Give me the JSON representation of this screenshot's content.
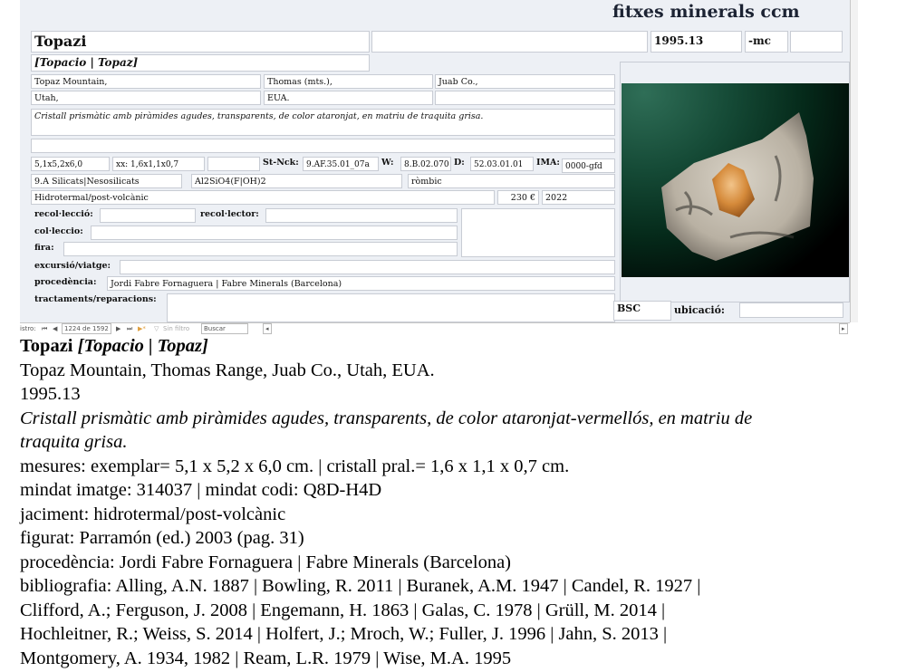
{
  "form": {
    "app_title": "fitxes minerals ccm",
    "name": "Topazi",
    "name_extra": "",
    "catalog_number": "1995.13",
    "suffix": "-mc",
    "extra_code": "",
    "synonyms": "[Topacio | Topaz]",
    "locality": [
      "Topaz Mountain,",
      "Thomas (mts.),",
      "Juab Co.,"
    ],
    "locality2": [
      "Utah,",
      "EUA.",
      ""
    ],
    "description": "Cristall prismàtic amb piràmides agudes, transparents, de color ataronjat, en matriu de traquita grisa.",
    "blank_line": "",
    "size": "5,1x5,2x6,0",
    "crystal_size": "xx: 1,6x1,1x0,7",
    "size_extra": "",
    "strunz_label": "St-Nck:",
    "strunz_value": "9.AF.35.01_07a",
    "w_label": "W:",
    "w_value": "8.B.02.070",
    "d_label": "D:",
    "d_value": "52.03.01.01",
    "ima_label": "IMA:",
    "ima_value": "0000-gfd",
    "class": "9.A Silicats|Nesosilicats",
    "formula": "Al2SiO4(F|OH)2",
    "system": "ròmbic",
    "deposit": "Hidrotermal/post-volcànic",
    "price": "230 €",
    "year": "2022",
    "recollection_label": "recol·lecció:",
    "recollection_value": "",
    "collector_label": "recol·lector:",
    "collector_value": "",
    "collection_label": "col·leccio:",
    "collection_value": "",
    "fair_label": "fira:",
    "fair_value": "",
    "trip_label": "excursió/viatge:",
    "trip_value": "",
    "provenance_label": "procedència:",
    "provenance_value": "Jordi Fabre Fornaguera | Fabre Minerals (Barcelona)",
    "treatments_label": "tractaments/reparacions:",
    "treatments_value": "",
    "bsc": "BSC",
    "location_label": "ubicació:",
    "location_value": "",
    "photo_alt": "topaz crystal on grey matrix"
  },
  "navigation": {
    "record_label": "istro:",
    "first": "⏮",
    "prev": "◀",
    "position": "1224 de 1592",
    "next": "▶",
    "last": "⏭",
    "new": "▶*",
    "filter": "Sin filtro",
    "search_placeholder": "Buscar"
  },
  "report": {
    "name": "Topazi",
    "synonyms": "[Topacio | Topaz]",
    "locality": "Topaz Mountain, Thomas Range, Juab Co., Utah, EUA.",
    "catalog_number": "1995.13",
    "description_1": "Cristall prismàtic amb piràmides agudes, transparents, de color ataronjat-vermellós, en matriu de",
    "description_2": "traquita grisa.",
    "measures": "mesures: exemplar= 5,1 x 5,2 x 6,0 cm. | cristall pral.= 1,6 x 1,1 x 0,7 cm.",
    "mindat": "mindat imatge: 314037 | mindat codi: Q8D-H4D",
    "deposit": "jaciment: hidrotermal/post-volcànic",
    "figured": "figurat: Parramón (ed.) 2003 (pag. 31)",
    "provenance": "procedència: Jordi Fabre Fornaguera | Fabre Minerals (Barcelona)",
    "bibliography": [
      "bibliografia: Alling, A.N. 1887 | Bowling, R. 2011 | Buranek, A.M. 1947 | Candel, R. 1927 |",
      "Clifford, A.; Ferguson, J. 2008 | Engemann, H. 1863 | Galas, C. 1978 | Grüll, M. 2014 |",
      "Hochleitner, R.; Weiss, S. 2014 |  Holfert, J.; Mroch, W.; Fuller, J. 1996 | Jahn, S. 2013 |",
      "Montgomery, A. 1934, 1982 | Ream, L.R. 1979 | Wise, M.A. 1995"
    ]
  }
}
